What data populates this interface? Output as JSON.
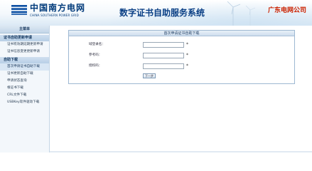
{
  "header": {
    "logo_cn": "中国南方电网",
    "logo_en": "CHINA SOUTHERN POWER GRID",
    "system_title": "数字证书自助服务系统",
    "company": "广东电网公司",
    "brand_color": "#003a7a",
    "company_color": "#cc2200"
  },
  "sidebar": {
    "header": "主菜单",
    "sections": [
      {
        "title": "证书自助更新申请",
        "items": [
          {
            "label": "证书有效期延期更新申请",
            "active": false
          },
          {
            "label": "证书信息变更更新申请",
            "active": false
          }
        ]
      },
      {
        "title": "自助下载",
        "items": [
          {
            "label": "首次申请证书自助下载",
            "active": true
          },
          {
            "label": "证书更新自助下载",
            "active": false
          },
          {
            "label": "申请状态查询",
            "active": false
          },
          {
            "label": "根证书下载",
            "active": false
          },
          {
            "label": "CRL文件下载",
            "active": false
          },
          {
            "label": "USBKey软件驱动下载",
            "active": false
          }
        ]
      }
    ]
  },
  "panel": {
    "title": "首次申请证书自助下载",
    "fields": [
      {
        "label": "域登录名：",
        "value": "",
        "required_mark": "*"
      },
      {
        "label": "参考码：",
        "value": "",
        "required_mark": "*"
      },
      {
        "label": "授权码：",
        "value": "",
        "required_mark": "*"
      }
    ],
    "next_button": "下一步"
  }
}
